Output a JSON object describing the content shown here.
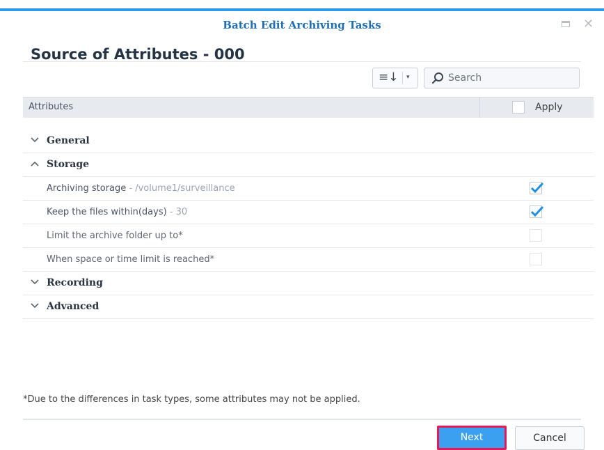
{
  "window": {
    "title": "Batch Edit Archiving Tasks",
    "accent": "#2f9be8"
  },
  "page": {
    "heading": "Source of Attributes - 000"
  },
  "toolbar": {
    "sort_icon": "sort-lines-icon",
    "search_placeholder": "Search",
    "search_value": ""
  },
  "table": {
    "col_attributes": "Attributes",
    "col_apply": "Apply",
    "header_checked": false,
    "groups": [
      {
        "label": "General",
        "expanded": false
      },
      {
        "label": "Storage",
        "expanded": true
      },
      {
        "label": "Recording",
        "expanded": false
      },
      {
        "label": "Advanced",
        "expanded": false
      }
    ],
    "storage_items": [
      {
        "label": "Archiving storage",
        "value": " - /volume1/surveillance",
        "checked": true,
        "enabled": true
      },
      {
        "label": "Keep the files within(days)",
        "value": " - 30",
        "checked": true,
        "enabled": true
      },
      {
        "label": "Limit the archive folder up to*",
        "value": "",
        "checked": false,
        "enabled": false
      },
      {
        "label": "When space or time limit is reached*",
        "value": "",
        "checked": false,
        "enabled": false
      }
    ]
  },
  "footer": {
    "note": "*Due to the differences in task types, some attributes may not be applied.",
    "next_label": "Next",
    "cancel_label": "Cancel",
    "next_color": "#3aa0ef",
    "highlight_color": "#e5195a"
  }
}
